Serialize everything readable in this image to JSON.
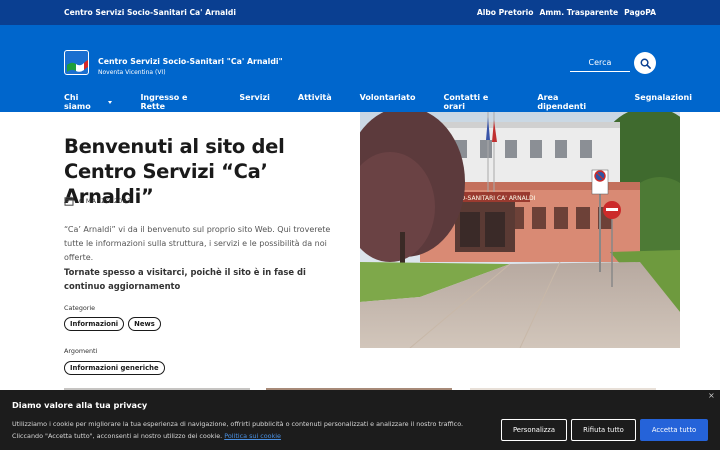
{
  "topbar": {
    "brand": "Centro Servizi Socio-Sanitari Ca' Arnaldi",
    "links": [
      "Albo Pretorio",
      "Amm. Trasparente",
      "PagoPA"
    ]
  },
  "header": {
    "site_name": "Centro Servizi Socio-Sanitari \"Ca' Arnaldi\"",
    "site_sub": "Noventa Vicentina (VI)",
    "search_label": "Cerca"
  },
  "nav": {
    "items": [
      "Chi siamo",
      "Ingresso e Rette",
      "Servizi",
      "Attività",
      "Volontariato",
      "Contatti e orari",
      "Area dipendenti",
      "Segnalazioni"
    ]
  },
  "article": {
    "title": "Benvenuti al sito del Centro Servizi “Ca’ Arnaldi”",
    "date": "6 MARZO 2023",
    "intro": "“Ca’ Arnaldi” vi da il benvenuto sul proprio sito Web. Qui troverete tutte le informazioni sulla struttura, i servizi e le possibilità da noi offerte.",
    "bold_text": "Tornate spesso a visitarci, poichè il sito è in fase di continuo aggiornamento",
    "categories_label": "Categorie",
    "categories": [
      "Informazioni",
      "News"
    ],
    "arguments_label": "Argomenti",
    "arguments": [
      "Informazioni generiche"
    ],
    "photo_sign": "SOCIO-SANITARI CA' ARNALDI"
  },
  "cookie": {
    "title": "Diamo valore alla tua privacy",
    "text": "Utilizziamo i cookie per migliorare la tua esperienza di navigazione, offrirti pubblicità o contenuti personalizzati e analizzare il nostro traffico. Cliccando \"Accetta tutto\", acconsenti al nostro utilizzo dei cookie.",
    "policy_link": "Politica sui cookie",
    "buttons": {
      "customize": "Personalizza",
      "reject": "Rifiuta tutto",
      "accept": "Accetta tutto"
    },
    "close": "×"
  },
  "colors": {
    "topbar_bg": "#0a3f91",
    "header_bg": "#0066cc",
    "cookie_bg": "#1c1c1c",
    "accept_bg": "#2563d9"
  },
  "icons": [
    "logo-flag-icon",
    "search-icon",
    "calendar-icon",
    "chevron-down-icon",
    "close-icon"
  ]
}
